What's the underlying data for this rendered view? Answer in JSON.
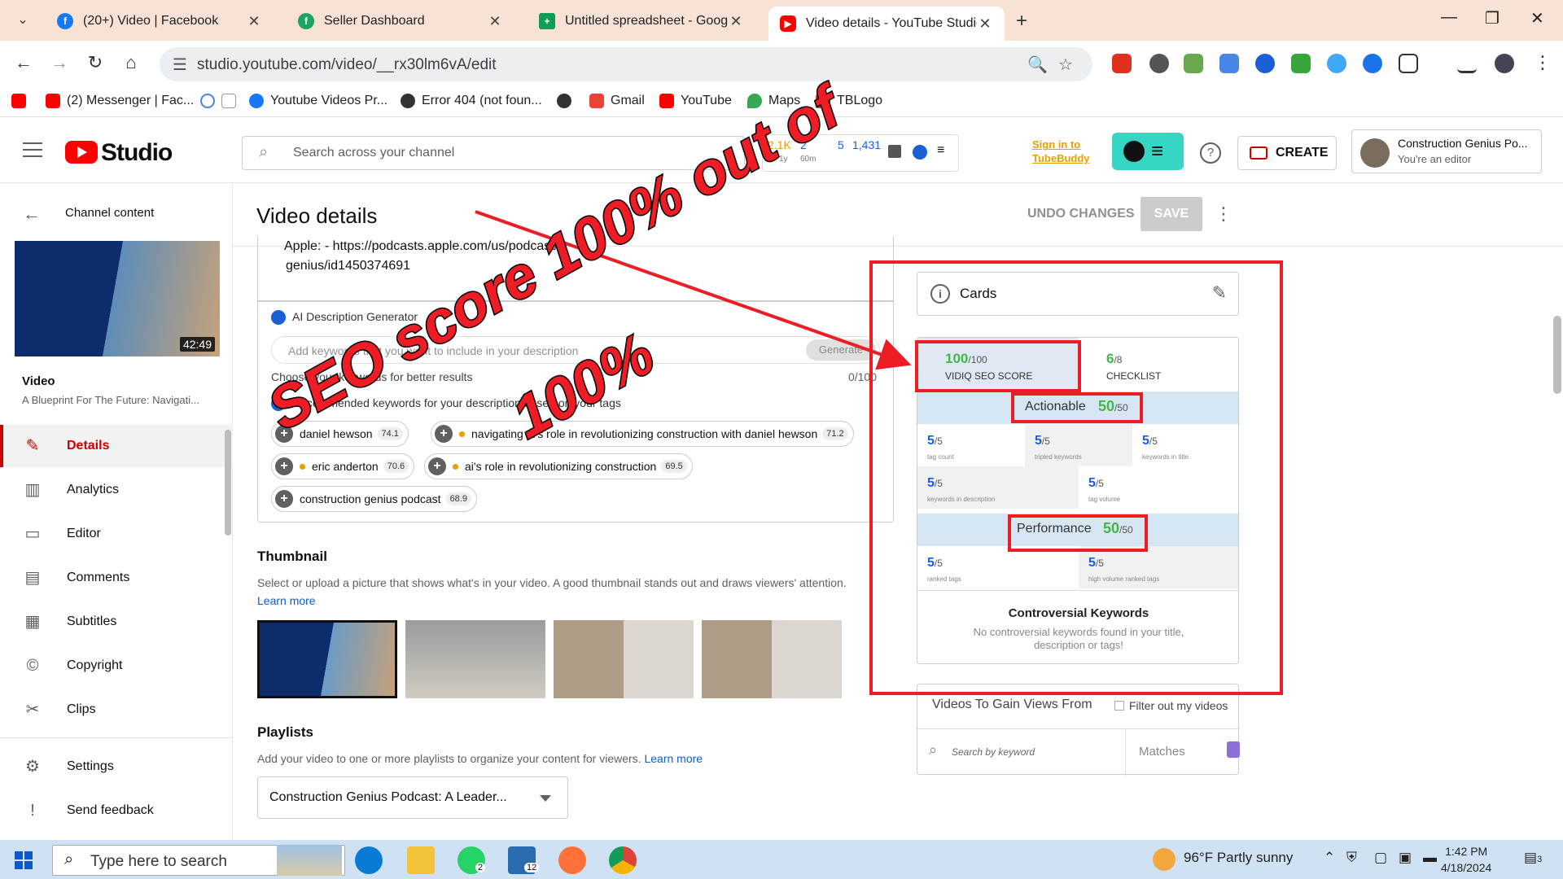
{
  "browser": {
    "tabs": [
      {
        "title": "(20+) Video | Facebook",
        "color": "#1877f2"
      },
      {
        "title": "Seller Dashboard",
        "color": "#1da462"
      },
      {
        "title": "Untitled spreadsheet - Google",
        "color": "#0f9d58"
      },
      {
        "title": "Video details - YouTube Studio",
        "color": "#ff0000"
      }
    ],
    "url": "studio.youtube.com/video/__rx30lm6vA/edit",
    "bookmarks": [
      "(2) Messenger | Fac...",
      "Youtube Videos Pr...",
      "Error 404 (not foun...",
      "Gmail",
      "YouTube",
      "Maps",
      "TBLogo"
    ]
  },
  "studio": {
    "logo_text": "Studio",
    "search_placeholder": "Search across your channel",
    "stats": {
      "a": "2.1K",
      "b": "2",
      "c": "5",
      "d": "1,431",
      "a_sub": "1y",
      "b_sub": "60m"
    },
    "signin": [
      "Sign in to",
      "TubeBuddy"
    ],
    "create_label": "CREATE",
    "account_name": "Construction Genius Po...",
    "account_role": "You're an editor"
  },
  "sidebar": {
    "back_label": "Channel content",
    "video_duration": "42:49",
    "video_label": "Video",
    "video_title": "A Blueprint For The Future: Navigati...",
    "items": [
      {
        "label": "Details",
        "icon": "pencil-icon"
      },
      {
        "label": "Analytics",
        "icon": "analytics-icon"
      },
      {
        "label": "Editor",
        "icon": "editor-icon"
      },
      {
        "label": "Comments",
        "icon": "comments-icon"
      },
      {
        "label": "Subtitles",
        "icon": "subtitles-icon"
      },
      {
        "label": "Copyright",
        "icon": "copyright-icon"
      },
      {
        "label": "Clips",
        "icon": "scissors-icon"
      },
      {
        "label": "Settings",
        "icon": "gear-icon"
      },
      {
        "label": "Send feedback",
        "icon": "feedback-icon"
      }
    ]
  },
  "main": {
    "title": "Video details",
    "undo_label": "UNDO CHANGES",
    "save_label": "SAVE",
    "description_tail1": "Apple: - https://podcasts.apple.com/us/podcast/",
    "description_tail2": "genius/id1450374691",
    "ai": {
      "title": "AI Description Generator",
      "placeholder": "Add keywords that you want to include in your description",
      "generate_label": "Generate",
      "hint": "Choose your keywords for better results",
      "count": "0/100",
      "recommended_label": "Recommended keywords for your description based on your tags",
      "chips": [
        {
          "text": "daniel hewson",
          "score": "74.1",
          "dot": false
        },
        {
          "text": "navigating ai's role in revolutionizing construction with daniel hewson",
          "score": "71.2",
          "dot": true
        },
        {
          "text": "eric anderton",
          "score": "70.6",
          "dot": true
        },
        {
          "text": "ai's role in revolutionizing construction",
          "score": "69.5",
          "dot": true
        },
        {
          "text": "construction genius podcast",
          "score": "68.9",
          "dot": false
        }
      ]
    },
    "thumbnail": {
      "title": "Thumbnail",
      "desc": "Select or upload a picture that shows what's in your video. A good thumbnail stands out and draws viewers' attention.",
      "learn_more": "Learn more"
    },
    "playlists": {
      "title": "Playlists",
      "desc": "Add your video to one or more playlists to organize your content for viewers.",
      "learn_more": "Learn more",
      "selected": "Construction Genius Podcast: A Leader..."
    }
  },
  "right": {
    "cards_label": "Cards",
    "seo": {
      "score": "100",
      "score_max": "/100",
      "score_label": "VIDIQ SEO SCORE",
      "checklist": "6",
      "checklist_max": "/8",
      "checklist_label": "CHECKLIST",
      "actionable_label": "Actionable",
      "actionable_value": "50",
      "actionable_max": "/50",
      "actionable_metrics": [
        {
          "value": "5",
          "max": "/5",
          "label": "tag count"
        },
        {
          "value": "5",
          "max": "/5",
          "label": "tripled keywords"
        },
        {
          "value": "5",
          "max": "/5",
          "label": "keywords in title"
        },
        {
          "value": "5",
          "max": "/5",
          "label": "keywords in description"
        },
        {
          "value": "5",
          "max": "/5",
          "label": "tag volume"
        }
      ],
      "performance_label": "Performance",
      "performance_value": "50",
      "performance_max": "/50",
      "performance_metrics": [
        {
          "value": "5",
          "max": "/5",
          "label": "ranked tags"
        },
        {
          "value": "5",
          "max": "/5",
          "label": "high volume ranked tags"
        }
      ],
      "controversial_title": "Controversial Keywords",
      "controversial_text": "No controversial keywords found in your title, description or tags!"
    },
    "gain": {
      "title": "Videos To Gain Views From",
      "filter_label": "Filter out my videos",
      "search_placeholder": "Search by keyword",
      "matches_label": "Matches"
    }
  },
  "annotation": {
    "line1": "SEO score 100% out of",
    "line2": "100%",
    "color": "#ee1c25"
  },
  "taskbar": {
    "search_placeholder": "Type here to search",
    "weather": "96°F  Partly sunny",
    "time": "1:42 PM",
    "date": "4/18/2024",
    "whatsapp_badge": "2",
    "mail_badge": "12",
    "notif_badge": "3"
  }
}
